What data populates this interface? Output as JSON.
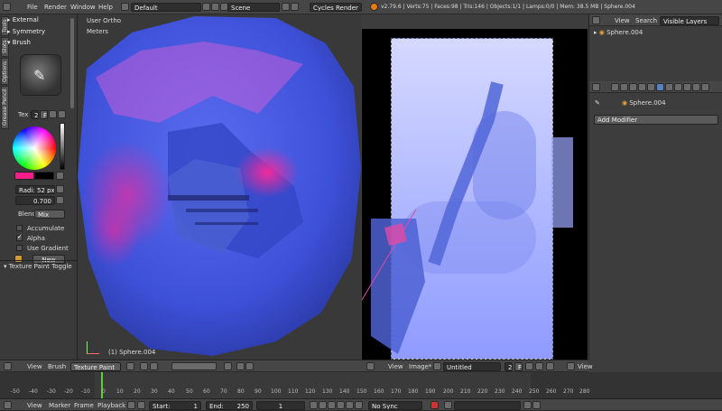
{
  "top": {
    "menu": [
      "File",
      "Render",
      "Window",
      "Help"
    ],
    "layout": "Default",
    "scene": "Scene",
    "engine": "Cycles Render",
    "stats": "v2.79.6 | Verts:75 | Faces:98 | Tris:146 | Objects:1/1 | Lamps:0/0 | Mem: 38.5 MB | Sphere.004"
  },
  "toolshelf": {
    "sections": {
      "external": "External",
      "symmetry": "Symmetry",
      "brush": "Brush"
    },
    "tex_label": "Tex",
    "tex_count": "2",
    "tex_f": "F",
    "radius": "Radi: 52 px",
    "strength": "0.700",
    "blend_label": "Blend:",
    "blend_value": "Mix",
    "checks": {
      "accumulate": "Accumulate",
      "alpha": "Alpha",
      "use_gradient": "Use Gradient"
    },
    "new_button": "New",
    "footer": "Texture Paint Toggle",
    "tabs": [
      "Tools",
      "Slots",
      "Options",
      "Grease Pencil"
    ],
    "colors": {
      "primary": "#f51d8c",
      "secondary": "#000000"
    }
  },
  "viewport3d": {
    "label1": "User Ortho",
    "label2": "Meters",
    "object": "(1) Sphere.004",
    "header": {
      "view": "View",
      "brush": "Brush",
      "mode": "Texture Paint"
    }
  },
  "image_editor": {
    "header": {
      "view": "View",
      "image": "Image*",
      "name": "Untitled",
      "users": "2",
      "f": "F",
      "view2": "View"
    }
  },
  "outliner": {
    "view": "View",
    "search": "Search",
    "filter": "Visible Layers",
    "item": "Sphere.004"
  },
  "properties": {
    "object": "Sphere.004",
    "add_modifier": "Add Modifier"
  },
  "timeline": {
    "ticks": [
      "-50",
      "-40",
      "-30",
      "-20",
      "-10",
      "0",
      "10",
      "20",
      "30",
      "40",
      "50",
      "60",
      "70",
      "80",
      "90",
      "100",
      "110",
      "120",
      "130",
      "140",
      "150",
      "160",
      "170",
      "180",
      "190",
      "200",
      "210",
      "220",
      "230",
      "240",
      "250",
      "260",
      "270",
      "280"
    ],
    "menu": [
      "View",
      "Marker",
      "Frame",
      "Playback"
    ],
    "start_label": "Start:",
    "start": "1",
    "end_label": "End:",
    "end": "250",
    "current": "1",
    "sync": "No Sync"
  }
}
